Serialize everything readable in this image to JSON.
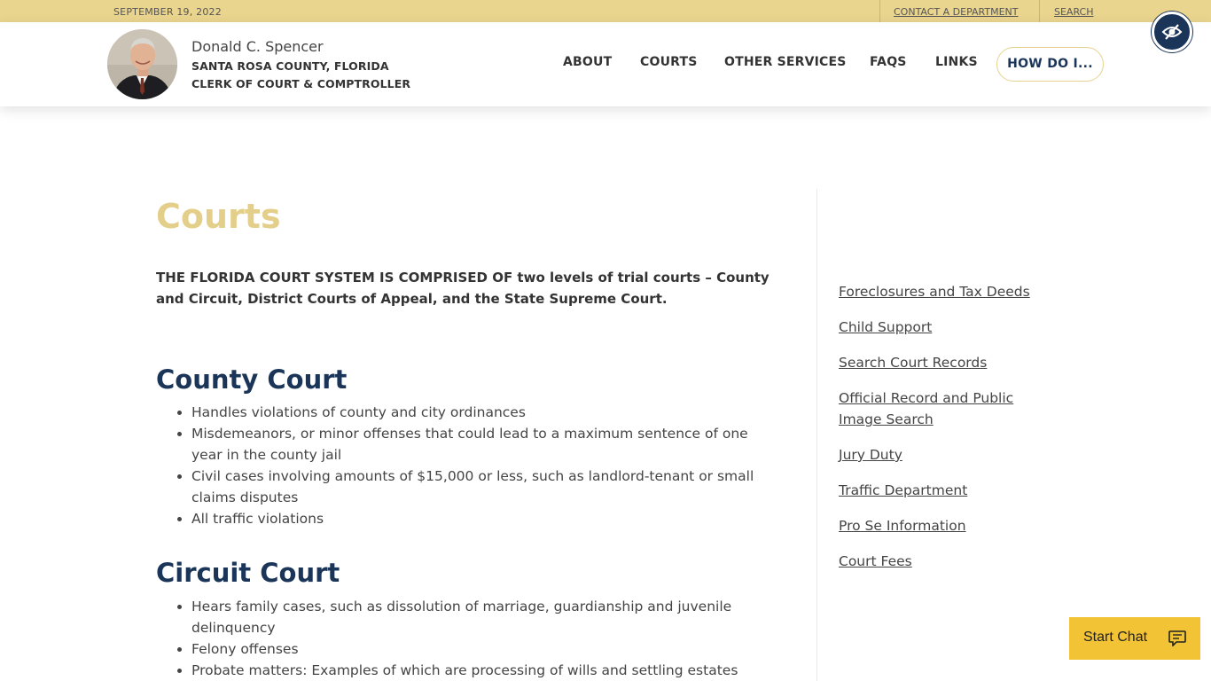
{
  "topbar": {
    "date": "SEPTEMBER 19, 2022",
    "contact_label": "CONTACT A DEPARTMENT",
    "search_label": "SEARCH"
  },
  "header": {
    "name": "Donald C. Spencer",
    "county": "SANTA ROSA COUNTY, FLORIDA",
    "title": "CLERK OF COURT & COMPTROLLER",
    "accessibility_icon": "eye-slash-icon"
  },
  "nav": {
    "items": [
      "ABOUT",
      "COURTS",
      "OTHER SERVICES",
      "FAQS",
      "LINKS"
    ],
    "cta": "HOW DO I..."
  },
  "main": {
    "title": "Courts",
    "intro": "THE FLORIDA COURT SYSTEM IS COMPRISED OF two levels of trial courts – County and Circuit, District Courts of Appeal, and the State Supreme Court.",
    "sections": [
      {
        "heading": "County Court",
        "items": [
          "Handles violations of county and city ordinances",
          "Misdemeanors, or minor offenses that could lead to a maximum sentence of one year in the county jail",
          "Civil cases involving amounts of $15,000 or less, such as landlord-tenant or small claims disputes",
          "All traffic violations"
        ]
      },
      {
        "heading": "Circuit Court",
        "items": [
          "Hears family cases, such as dissolution of marriage, guardianship and juvenile delinquency",
          "Felony offenses",
          "Probate matters: Examples of which are processing of wills and settling estates"
        ]
      }
    ]
  },
  "sidebar": {
    "links": [
      "Foreclosures and Tax Deeds",
      "Child Support",
      "Search Court Records",
      "Official Record and Public Image Search",
      "Jury Duty",
      "Traffic Department",
      "Pro Se Information",
      "Court Fees"
    ]
  },
  "chat": {
    "label": "Start Chat",
    "icon": "chat-bubble-icon"
  },
  "colors": {
    "gold": "#ead58e",
    "navy": "#1b3558",
    "chat": "#f2c335"
  }
}
